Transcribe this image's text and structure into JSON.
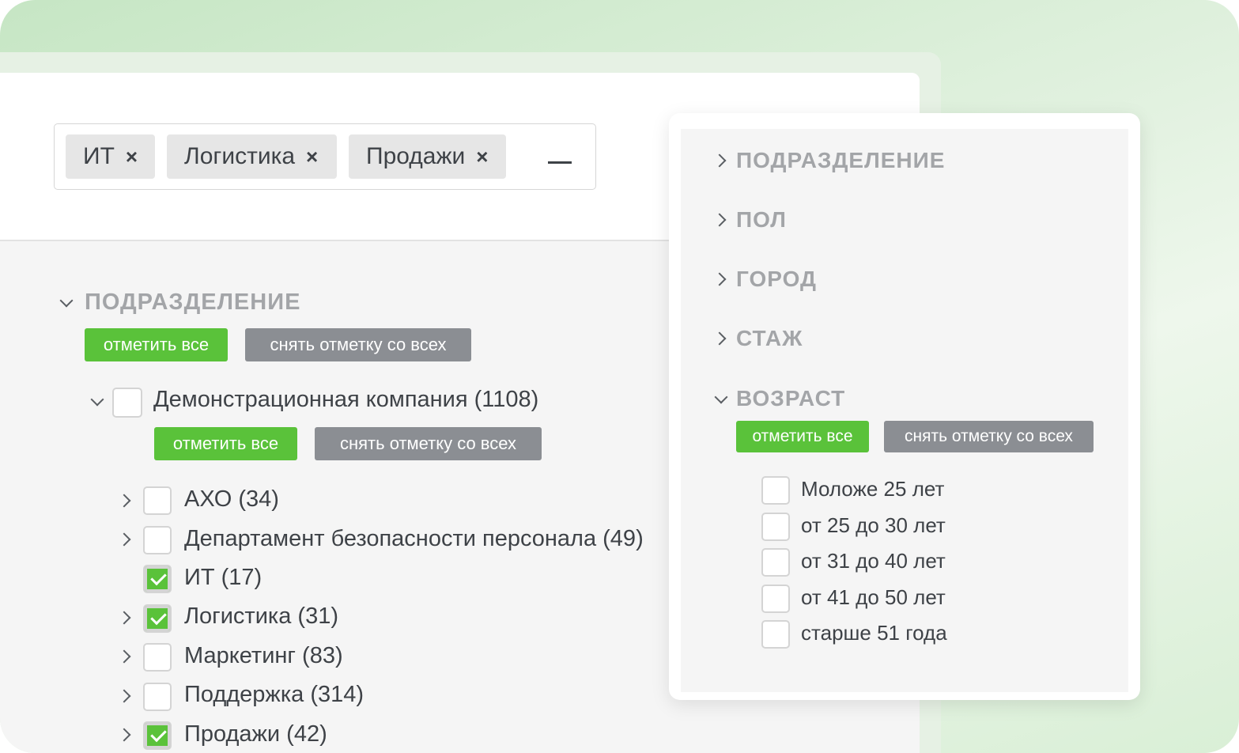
{
  "tags": [
    {
      "label": "ИТ",
      "remove": "×"
    },
    {
      "label": "Логистика",
      "remove": "×"
    },
    {
      "label": "Продажи",
      "remove": "×"
    }
  ],
  "collapse_symbol": "—",
  "main": {
    "section_title": "ПОДРАЗДЕЛЕНИЕ",
    "select_all": "отметить все",
    "deselect_all": "снять отметку со всех",
    "company": {
      "label": "Демонстрационная компания (1108)",
      "select_all": "отметить все",
      "deselect_all": "снять отметку со всех",
      "children": [
        {
          "label": "АХО (34)",
          "checked": false,
          "expandable": true
        },
        {
          "label": "Департамент безопасности персонала (49)",
          "checked": false,
          "expandable": true
        },
        {
          "label": "ИТ (17)",
          "checked": true,
          "expandable": false
        },
        {
          "label": "Логистика (31)",
          "checked": true,
          "expandable": true
        },
        {
          "label": "Маркетинг (83)",
          "checked": false,
          "expandable": true
        },
        {
          "label": "Поддержка (314)",
          "checked": false,
          "expandable": true
        },
        {
          "label": "Продажи (42)",
          "checked": true,
          "expandable": true
        }
      ]
    }
  },
  "popup": {
    "sections": [
      "ПОДРАЗДЕЛЕНИЕ",
      "ПОЛ",
      "ГОРОД",
      "СТАЖ",
      "ВОЗРАСТ"
    ],
    "select_all": "отметить все",
    "deselect_all": "снять отметку со всех",
    "age_options": [
      {
        "label": "Моложе 25 лет",
        "checked": false
      },
      {
        "label": "от 25 до 30 лет",
        "checked": false
      },
      {
        "label": "от 31 до 40 лет",
        "checked": false
      },
      {
        "label": "от 41 до 50 лет",
        "checked": false
      },
      {
        "label": "старше 51 года",
        "checked": false
      }
    ]
  },
  "colors": {
    "accent_green": "#5ac23a",
    "grey_button": "#8b8e93"
  }
}
